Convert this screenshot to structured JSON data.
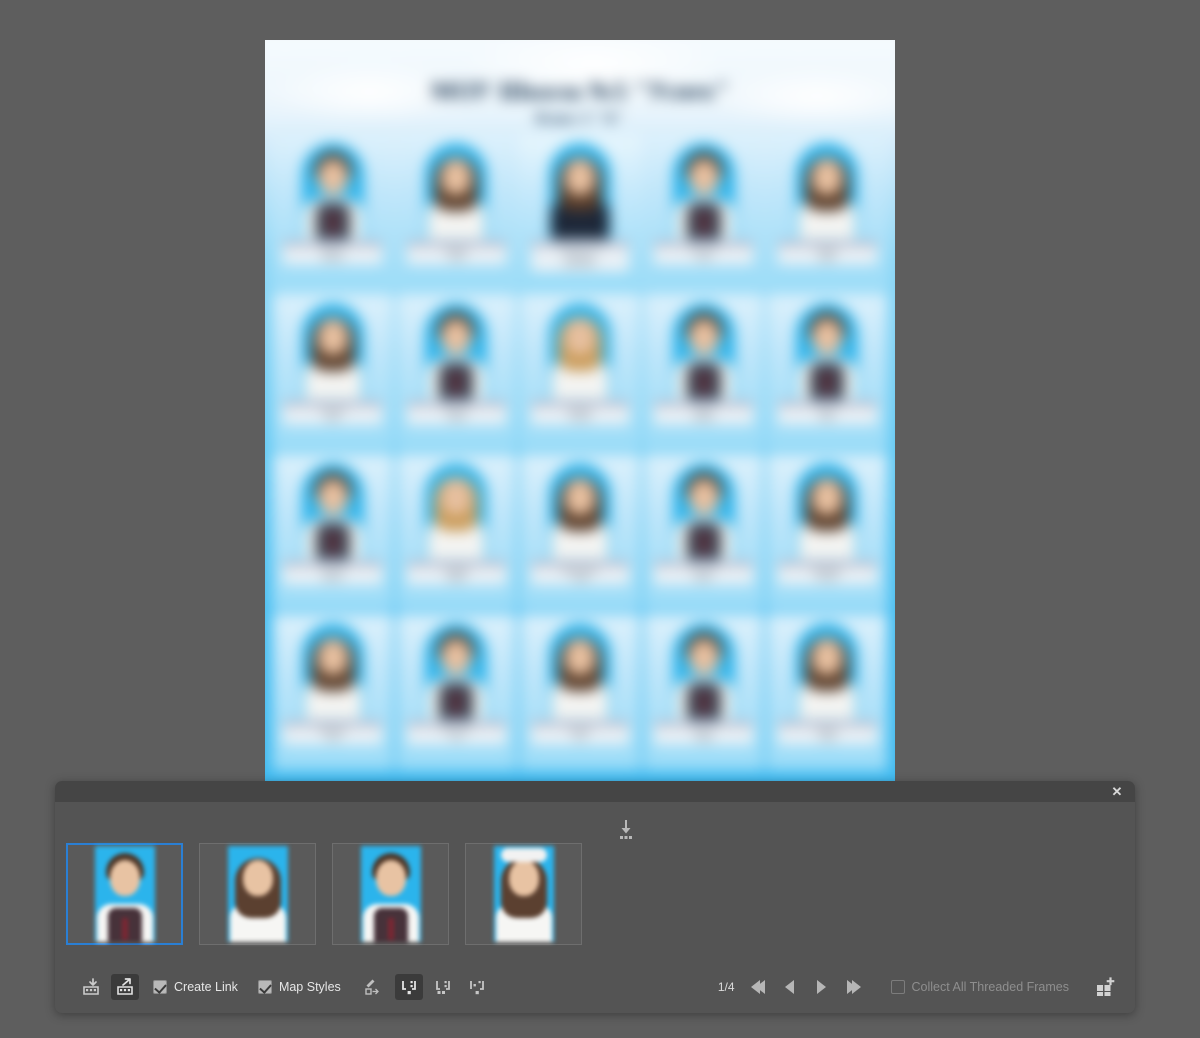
{
  "app": {
    "background_color": "#5e5e5e",
    "panel_color": "#545454",
    "panel_header_color": "#454545",
    "accent_color": "#2a7fd4"
  },
  "document": {
    "title": "МОУ Школа №5 \"Успех\"",
    "subtitle": "Класс 1 \"А\"",
    "poster_background_color": "#46bdf1",
    "cells": [
      {
        "name_line1": "Иванов",
        "name_line2": "Максим",
        "role": "",
        "style": "boy"
      },
      {
        "name_line1": "Петрова",
        "name_line2": "Алиса",
        "role": "",
        "style": "girl"
      },
      {
        "name_line1": "Смирнова Е. В.",
        "name_line2": "классный",
        "role": "руководитель",
        "style": "teacher"
      },
      {
        "name_line1": "Кузнецов",
        "name_line2": "Егор",
        "role": "",
        "style": "boy"
      },
      {
        "name_line1": "Попова",
        "name_line2": "Дарья",
        "role": "",
        "style": "girl"
      },
      {
        "name_line1": "Соколова",
        "name_line2": "Вика",
        "role": "",
        "style": "girl"
      },
      {
        "name_line1": "Морозов",
        "name_line2": "Артём",
        "role": "",
        "style": "boy"
      },
      {
        "name_line1": "Волкова",
        "name_line2": "Полина",
        "role": "",
        "style": "blonde"
      },
      {
        "name_line1": "Зайцев",
        "name_line2": "Матвей",
        "role": "",
        "style": "boy"
      },
      {
        "name_line1": "Павлов",
        "name_line2": "Илья",
        "role": "",
        "style": "boy"
      },
      {
        "name_line1": "Семёнов",
        "name_line2": "Никита",
        "role": "",
        "style": "boy"
      },
      {
        "name_line1": "Голубева",
        "name_line2": "Мария",
        "role": "",
        "style": "blonde"
      },
      {
        "name_line1": "Виноградова",
        "name_line2": "Софья",
        "role": "",
        "style": "girl"
      },
      {
        "name_line1": "Богданов",
        "name_line2": "Денис",
        "role": "",
        "style": "boy"
      },
      {
        "name_line1": "Воробьёва",
        "name_line2": "Ксения",
        "role": "",
        "style": "girl"
      },
      {
        "name_line1": "Фёдорова",
        "name_line2": "Анна",
        "role": "",
        "style": "girl"
      },
      {
        "name_line1": "Михайлов",
        "name_line2": "Лев",
        "role": "",
        "style": "boy"
      },
      {
        "name_line1": "Беляева",
        "name_line2": "Ева",
        "role": "",
        "style": "girl"
      },
      {
        "name_line1": "Тарасов",
        "name_line2": "Тимур",
        "role": "",
        "style": "boy"
      },
      {
        "name_line1": "Орлова",
        "name_line2": "Алина",
        "role": "",
        "style": "girl"
      }
    ]
  },
  "conveyor": {
    "close_label": "✕",
    "place_icon": "place-gun-icon",
    "thumbnails": [
      {
        "alt": "boy in plaid vest with tie",
        "style": "boy",
        "selected": true
      },
      {
        "alt": "girl with braids",
        "style": "girl",
        "selected": false
      },
      {
        "alt": "boy in plaid vest",
        "style": "boy",
        "selected": false
      },
      {
        "alt": "girl with white hair bows",
        "style": "bow",
        "selected": false
      }
    ],
    "toolbar": {
      "collector_icon": "content-collector-icon",
      "placer_icon": "content-placer-icon",
      "create_link_label": "Create Link",
      "create_link_checked": true,
      "map_styles_label": "Map Styles",
      "map_styles_checked": true,
      "edit_custom_style_mapping_icon": "edit-style-mapping-icon",
      "modes": [
        {
          "icon": "place-keep-format-icon",
          "active": true
        },
        {
          "icon": "place-remove-format-icon",
          "active": false
        },
        {
          "icon": "place-multiple-icon",
          "active": false
        }
      ],
      "page_indicator": "1/4",
      "nav_first_icon": "nav-first-icon",
      "nav_prev_icon": "nav-prev-icon",
      "nav_next_icon": "nav-next-icon",
      "nav_last_icon": "nav-last-icon",
      "collect_all_label": "Collect All Threaded Frames",
      "collect_all_checked": false,
      "collect_all_disabled": true,
      "load_conveyor_icon": "load-conveyor-icon"
    }
  }
}
